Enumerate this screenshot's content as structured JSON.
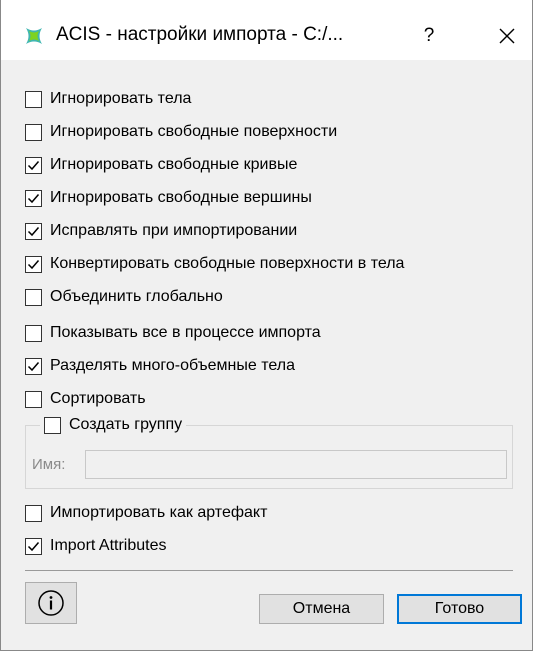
{
  "window": {
    "title": "ACIS - настройки импорта - C:/...",
    "help_label": "?",
    "accent_color": "#0078d7",
    "icon": "acis-logo-icon"
  },
  "options": [
    {
      "label": "Игнорировать тела",
      "checked": false
    },
    {
      "label": "Игнорировать свободные поверхности",
      "checked": false
    },
    {
      "label": "Игнорировать свободные кривые",
      "checked": true
    },
    {
      "label": "Игнорировать свободные вершины",
      "checked": true
    },
    {
      "label": "Исправлять при импортировании",
      "checked": true
    },
    {
      "label": "Конвертировать свободные поверхности в тела",
      "checked": true
    },
    {
      "label": "Объединить глобально",
      "checked": false
    },
    {
      "label": "Показывать все в процессе импорта",
      "checked": false
    },
    {
      "label": "Разделять много-объемные тела",
      "checked": true
    },
    {
      "label": "Сортировать",
      "checked": false
    }
  ],
  "group": {
    "label": "Создать группу",
    "checked": false,
    "name_label": "Имя:",
    "name_value": ""
  },
  "bottom_options": [
    {
      "label": "Импортировать как артефакт",
      "checked": false
    },
    {
      "label": "Import Attributes",
      "checked": true
    }
  ],
  "buttons": {
    "info_icon": "info-icon",
    "cancel_label": "Отмена",
    "ok_label": "Готово"
  }
}
